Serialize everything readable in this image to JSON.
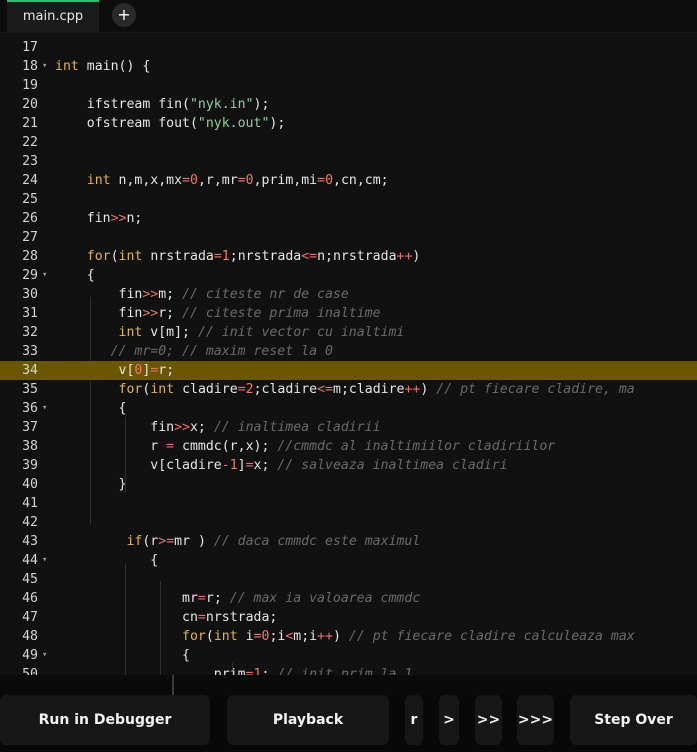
{
  "tabs": {
    "file_name": "main.cpp",
    "add_label": "+"
  },
  "editor": {
    "lines": [
      {
        "n": "17",
        "fold": false,
        "tokens": []
      },
      {
        "n": "18",
        "fold": true,
        "tokens": [
          {
            "t": "int",
            "c": "kw"
          },
          {
            "t": " main() {"
          }
        ]
      },
      {
        "n": "19",
        "fold": false,
        "tokens": []
      },
      {
        "n": "20",
        "fold": false,
        "tokens": [
          {
            "t": "    ifstream fin("
          },
          {
            "t": "\"nyk.in\"",
            "c": "str"
          },
          {
            "t": ");"
          }
        ]
      },
      {
        "n": "21",
        "fold": false,
        "tokens": [
          {
            "t": "    ofstream fout("
          },
          {
            "t": "\"nyk.out\"",
            "c": "str"
          },
          {
            "t": ");"
          }
        ]
      },
      {
        "n": "22",
        "fold": false,
        "tokens": []
      },
      {
        "n": "23",
        "fold": false,
        "tokens": []
      },
      {
        "n": "24",
        "fold": false,
        "tokens": [
          {
            "t": "    "
          },
          {
            "t": "int",
            "c": "kw"
          },
          {
            "t": " n,m,x,mx"
          },
          {
            "t": "=",
            "c": "op"
          },
          {
            "t": "0",
            "c": "num"
          },
          {
            "t": ",r,mr"
          },
          {
            "t": "=",
            "c": "op"
          },
          {
            "t": "0",
            "c": "num"
          },
          {
            "t": ",prim,mi"
          },
          {
            "t": "=",
            "c": "op"
          },
          {
            "t": "0",
            "c": "num"
          },
          {
            "t": ",cn,cm;"
          }
        ]
      },
      {
        "n": "25",
        "fold": false,
        "tokens": []
      },
      {
        "n": "26",
        "fold": false,
        "tokens": [
          {
            "t": "    fin"
          },
          {
            "t": ">>",
            "c": "op"
          },
          {
            "t": "n;"
          }
        ]
      },
      {
        "n": "27",
        "fold": false,
        "tokens": []
      },
      {
        "n": "28",
        "fold": false,
        "tokens": [
          {
            "t": "    "
          },
          {
            "t": "for",
            "c": "kw"
          },
          {
            "t": "("
          },
          {
            "t": "int",
            "c": "kw"
          },
          {
            "t": " nrstrada"
          },
          {
            "t": "=",
            "c": "op"
          },
          {
            "t": "1",
            "c": "num"
          },
          {
            "t": ";nrstrada"
          },
          {
            "t": "<=",
            "c": "op"
          },
          {
            "t": "n;nrstrada"
          },
          {
            "t": "++",
            "c": "op"
          },
          {
            "t": ")"
          }
        ]
      },
      {
        "n": "29",
        "fold": true,
        "tokens": [
          {
            "t": "    {"
          }
        ]
      },
      {
        "n": "30",
        "fold": false,
        "tokens": [
          {
            "t": "        fin"
          },
          {
            "t": ">>",
            "c": "op"
          },
          {
            "t": "m; "
          },
          {
            "t": "// citeste nr de case",
            "c": "cm"
          }
        ]
      },
      {
        "n": "31",
        "fold": false,
        "tokens": [
          {
            "t": "        fin"
          },
          {
            "t": ">>",
            "c": "op"
          },
          {
            "t": "r; "
          },
          {
            "t": "// citeste prima inaltime",
            "c": "cm"
          }
        ]
      },
      {
        "n": "32",
        "fold": false,
        "tokens": [
          {
            "t": "        "
          },
          {
            "t": "int",
            "c": "kw"
          },
          {
            "t": " v[m]; "
          },
          {
            "t": "// init vector cu inaltimi",
            "c": "cm"
          }
        ]
      },
      {
        "n": "33",
        "fold": false,
        "tokens": [
          {
            "t": "       "
          },
          {
            "t": "// mr=0; // maxim reset la 0",
            "c": "cm"
          }
        ]
      },
      {
        "n": "34",
        "fold": false,
        "hl": true,
        "tokens": [
          {
            "t": "        v["
          },
          {
            "t": "0",
            "c": "num"
          },
          {
            "t": "]"
          },
          {
            "t": "=",
            "c": "op"
          },
          {
            "t": "r;"
          }
        ]
      },
      {
        "n": "35",
        "fold": false,
        "tokens": [
          {
            "t": "        "
          },
          {
            "t": "for",
            "c": "kw"
          },
          {
            "t": "("
          },
          {
            "t": "int",
            "c": "kw"
          },
          {
            "t": " cladire"
          },
          {
            "t": "=",
            "c": "op"
          },
          {
            "t": "2",
            "c": "num"
          },
          {
            "t": ";cladire"
          },
          {
            "t": "<=",
            "c": "op"
          },
          {
            "t": "m;cladire"
          },
          {
            "t": "++",
            "c": "op"
          },
          {
            "t": ") "
          },
          {
            "t": "// pt fiecare cladire, ma",
            "c": "cm"
          }
        ]
      },
      {
        "n": "36",
        "fold": true,
        "tokens": [
          {
            "t": "        {"
          }
        ]
      },
      {
        "n": "37",
        "fold": false,
        "tokens": [
          {
            "t": "            fin"
          },
          {
            "t": ">>",
            "c": "op"
          },
          {
            "t": "x; "
          },
          {
            "t": "// inaltimea cladirii",
            "c": "cm"
          }
        ]
      },
      {
        "n": "38",
        "fold": false,
        "tokens": [
          {
            "t": "            r "
          },
          {
            "t": "=",
            "c": "op"
          },
          {
            "t": " cmmdc(r,x); "
          },
          {
            "t": "//cmmdc al inaltimiilor cladiriilor",
            "c": "cm"
          }
        ]
      },
      {
        "n": "39",
        "fold": false,
        "tokens": [
          {
            "t": "            v[cladire"
          },
          {
            "t": "-",
            "c": "op"
          },
          {
            "t": "1",
            "c": "num"
          },
          {
            "t": "]"
          },
          {
            "t": "=",
            "c": "op"
          },
          {
            "t": "x; "
          },
          {
            "t": "// salveaza inaltimea cladiri",
            "c": "cm"
          }
        ]
      },
      {
        "n": "40",
        "fold": false,
        "tokens": [
          {
            "t": "        }"
          }
        ]
      },
      {
        "n": "41",
        "fold": false,
        "tokens": []
      },
      {
        "n": "42",
        "fold": false,
        "tokens": []
      },
      {
        "n": "43",
        "fold": false,
        "tokens": [
          {
            "t": "         "
          },
          {
            "t": "if",
            "c": "kw"
          },
          {
            "t": "(r"
          },
          {
            "t": ">=",
            "c": "op"
          },
          {
            "t": "mr ) "
          },
          {
            "t": "// daca cmmdc este maximul",
            "c": "cm"
          }
        ]
      },
      {
        "n": "44",
        "fold": true,
        "tokens": [
          {
            "t": "            {"
          }
        ]
      },
      {
        "n": "45",
        "fold": false,
        "tokens": []
      },
      {
        "n": "46",
        "fold": false,
        "tokens": [
          {
            "t": "                mr"
          },
          {
            "t": "=",
            "c": "op"
          },
          {
            "t": "r; "
          },
          {
            "t": "// max ia valoarea cmmdc",
            "c": "cm"
          }
        ]
      },
      {
        "n": "47",
        "fold": false,
        "tokens": [
          {
            "t": "                cn"
          },
          {
            "t": "=",
            "c": "op"
          },
          {
            "t": "nrstrada;"
          }
        ]
      },
      {
        "n": "48",
        "fold": false,
        "tokens": [
          {
            "t": "                "
          },
          {
            "t": "for",
            "c": "kw"
          },
          {
            "t": "("
          },
          {
            "t": "int",
            "c": "kw"
          },
          {
            "t": " i"
          },
          {
            "t": "=",
            "c": "op"
          },
          {
            "t": "0",
            "c": "num"
          },
          {
            "t": ";i"
          },
          {
            "t": "<",
            "c": "op"
          },
          {
            "t": "m;i"
          },
          {
            "t": "++",
            "c": "op"
          },
          {
            "t": ") "
          },
          {
            "t": "// pt fiecare cladire calculeaza max",
            "c": "cm"
          }
        ]
      },
      {
        "n": "49",
        "fold": true,
        "tokens": [
          {
            "t": "                {"
          }
        ]
      },
      {
        "n": "50",
        "fold": false,
        "tokens": [
          {
            "t": "                    prim"
          },
          {
            "t": "=",
            "c": "op"
          },
          {
            "t": "1",
            "c": "num"
          },
          {
            "t": "; "
          },
          {
            "t": "// init prim la 1",
            "c": "cm"
          }
        ]
      }
    ]
  },
  "toolbar": {
    "run_debugger": "Run in Debugger",
    "playback": "Playback",
    "reverse": "r",
    "step1": ">",
    "step2": ">>",
    "step3": ">>>",
    "step_over": "Step Over"
  }
}
